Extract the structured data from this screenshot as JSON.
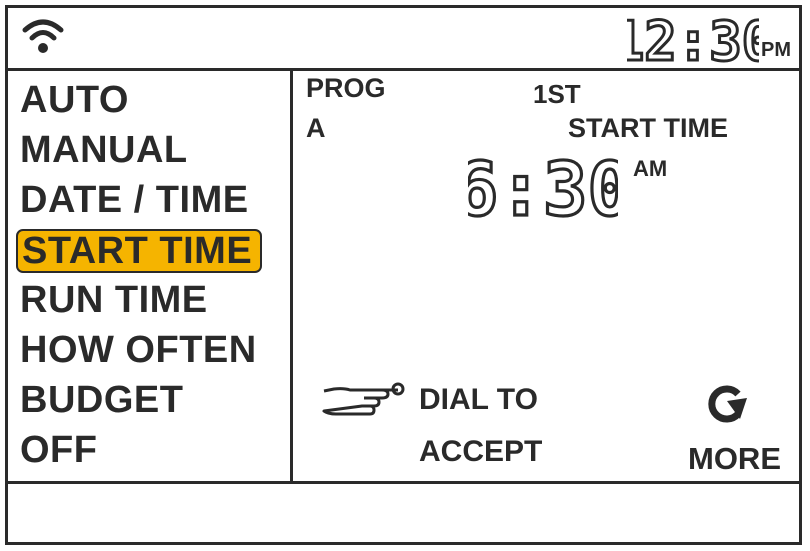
{
  "status_bar": {
    "clock": {
      "time": "12:30",
      "ampm": "PM"
    },
    "wifi_icon": "wifi-icon"
  },
  "menu": {
    "items": [
      {
        "label": "AUTO"
      },
      {
        "label": "MANUAL"
      },
      {
        "label": "DATE / TIME"
      },
      {
        "label": "START TIME",
        "selected": true
      },
      {
        "label": "RUN TIME"
      },
      {
        "label": "HOW OFTEN"
      },
      {
        "label": "BUDGET"
      },
      {
        "label": "OFF"
      }
    ]
  },
  "detail": {
    "prog_label": "PROG",
    "prog_value": "A",
    "ordinal": "1ST",
    "title": "START TIME",
    "time": "6:30",
    "ampm": "AM",
    "instruction_line1": "DIAL TO",
    "instruction_line2": "ACCEPT",
    "more_label": "MORE",
    "hand_icon": "pointing-hand-icon",
    "more_icon": "rotate-arrow-icon"
  },
  "colors": {
    "highlight": "#f5b400",
    "ink": "#2a2a2a"
  }
}
